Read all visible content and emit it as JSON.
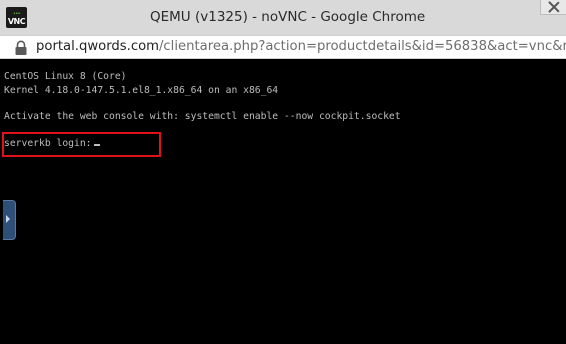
{
  "window": {
    "title": "QEMU (v1325) - noVNC - Google Chrome",
    "favicon": {
      "top": "…",
      "bottom": "VNC",
      "icon": "novnc-logo-icon"
    }
  },
  "addressbar": {
    "icon": "lock-icon",
    "url_host": "portal.qwords.com",
    "url_path": "/clientarea.php?action=productdetails&id=56838&act=vnc&r"
  },
  "terminal": {
    "lines": [
      "CentOS Linux 8 (Core)",
      "Kernel 4.18.0-147.5.1.el8_1.x86_64 on an x86_64",
      "",
      "Activate the web console with: systemctl enable --now cockpit.socket",
      "",
      "serverkb login:"
    ],
    "highlight_color": "#e0111a",
    "text_color": "#bdbdbd",
    "background": "#000000"
  },
  "sidebar_handle": {
    "icon": "chevron-right-icon",
    "color": "#2d4f78"
  }
}
